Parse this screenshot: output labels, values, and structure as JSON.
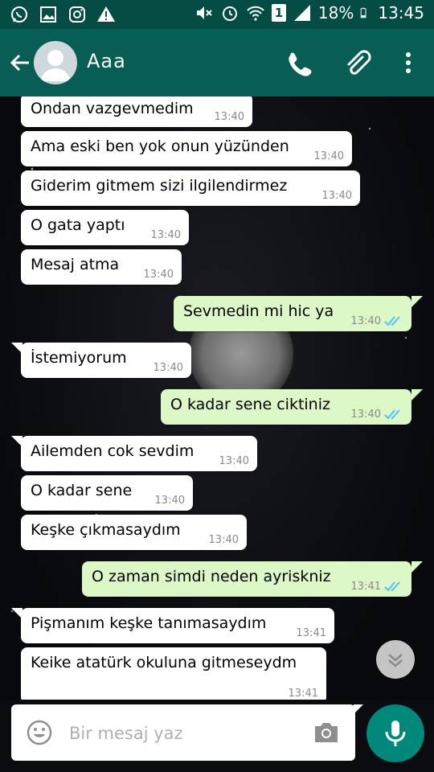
{
  "status_bar": {
    "battery_percent": "18%",
    "time": "13:45",
    "sim_label": "1",
    "icons": [
      "whatsapp-icon",
      "gallery-icon",
      "instagram-icon",
      "warning-icon",
      "mute-icon",
      "alarm-icon",
      "wifi-icon",
      "sim-icon",
      "signal-icon",
      "battery-icon"
    ]
  },
  "header": {
    "contact_name": "Aaa"
  },
  "messages": [
    {
      "dir": "in",
      "text": "Ondan vazgevmedim",
      "time": "13:40"
    },
    {
      "dir": "in",
      "text": "Ama eski ben yok onun yüzünden",
      "time": "13:40"
    },
    {
      "dir": "in",
      "text": "Giderim gitmem sizi ilgilendirmez",
      "time": "13:40"
    },
    {
      "dir": "in",
      "text": "O gata yaptı",
      "time": "13:40"
    },
    {
      "dir": "in",
      "text": "Mesaj atma",
      "time": "13:40"
    },
    {
      "dir": "out",
      "text": "Sevmedin mi hic ya",
      "time": "13:40",
      "read": true
    },
    {
      "dir": "in",
      "text": "İstemiyorum",
      "time": "13:40"
    },
    {
      "dir": "out",
      "text": "O kadar sene ciktiniz",
      "time": "13:40",
      "read": true
    },
    {
      "dir": "in",
      "text": "Ailemden cok sevdim",
      "time": "13:40"
    },
    {
      "dir": "in",
      "text": "O kadar sene",
      "time": "13:40"
    },
    {
      "dir": "in",
      "text": "Keşke çıkmasaydım",
      "time": "13:40"
    },
    {
      "dir": "out",
      "text": "O zaman simdi neden ayriskniz",
      "time": "13:41",
      "read": true
    },
    {
      "dir": "in",
      "text": "Pişmanım keşke tanımasaydım",
      "time": "13:41"
    },
    {
      "dir": "in",
      "text": "Keike atatürk okuluna gitmeseydm",
      "time": "13:41"
    }
  ],
  "composer": {
    "placeholder": "Bir mesaj yaz",
    "value": ""
  },
  "colors": {
    "header": "#075e54",
    "status_bar": "#054d44",
    "outgoing_bubble": "#dcf8c6",
    "incoming_bubble": "#ffffff",
    "read_ticks": "#4fc3f7",
    "mic_button": "#00897b"
  }
}
